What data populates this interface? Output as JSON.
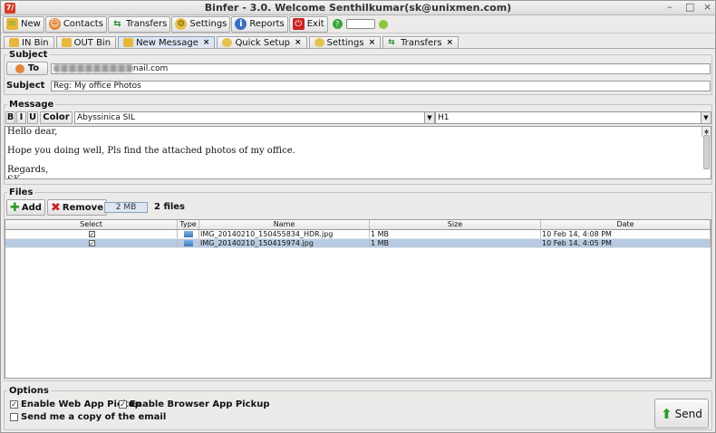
{
  "window": {
    "title": "Binfer - 3.0. Welcome Senthilkumar(sk@unixmen.com)",
    "app_icon_glyph": "7/",
    "controls": [
      "–",
      "□",
      "×"
    ]
  },
  "toolbar": {
    "new_label": "New",
    "contacts_label": "Contacts",
    "transfers_label": "Transfers",
    "settings_label": "Settings",
    "reports_label": "Reports",
    "exit_label": "Exit"
  },
  "tabs": [
    {
      "label": "IN Bin",
      "closable": false
    },
    {
      "label": "OUT Bin",
      "closable": false
    },
    {
      "label": "New Message",
      "closable": true,
      "active": true
    },
    {
      "label": "Quick Setup",
      "closable": true
    },
    {
      "label": "Settings",
      "closable": true
    },
    {
      "label": "Transfers",
      "closable": true
    }
  ],
  "subject_section": {
    "legend": "Subject",
    "to_button": "To",
    "to_value_visible_suffix": "nail.com",
    "subject_label": "Subject",
    "subject_value": "Reg: My office Photos"
  },
  "message_section": {
    "legend": "Message",
    "bold": "B",
    "italic": "I",
    "underline": "U",
    "color_label": "Color",
    "font_value": "Abyssinica SIL",
    "heading_value": "H1",
    "body_lines": [
      "Hello dear,",
      "",
      "Hope you doing well, Pls find the attached photos of my office.",
      "",
      "Regards,",
      "SK"
    ]
  },
  "files_section": {
    "legend": "Files",
    "add_label": "Add",
    "remove_label": "Remove",
    "total_size": "2 MB",
    "file_count": "2 files",
    "columns": [
      "Select",
      "Type",
      "Name",
      "Size",
      "Date"
    ],
    "rows": [
      {
        "checked": true,
        "name": "IMG_20140210_150455834_HDR.jpg",
        "size": "1 MB",
        "date": "10 Feb 14, 4:08 PM",
        "selected": false
      },
      {
        "checked": true,
        "name": "IMG_20140210_150415974.jpg",
        "size": "1 MB",
        "date": "10 Feb 14, 4:05 PM",
        "selected": true
      }
    ]
  },
  "options_section": {
    "legend": "Options",
    "web_app_pickup": "Enable Web App Pickup",
    "browser_app_pickup": "Enable Browser App Pickup",
    "send_copy": "Send me a copy of the email",
    "web_app_pickup_checked": true,
    "browser_app_pickup_checked": true,
    "send_copy_checked": false,
    "send_label": "Send"
  },
  "colors": {
    "accent": "#dde6f2",
    "selection": "#b9cbe3",
    "exit_red": "#cc2222",
    "send_green": "#2a9a2a"
  }
}
